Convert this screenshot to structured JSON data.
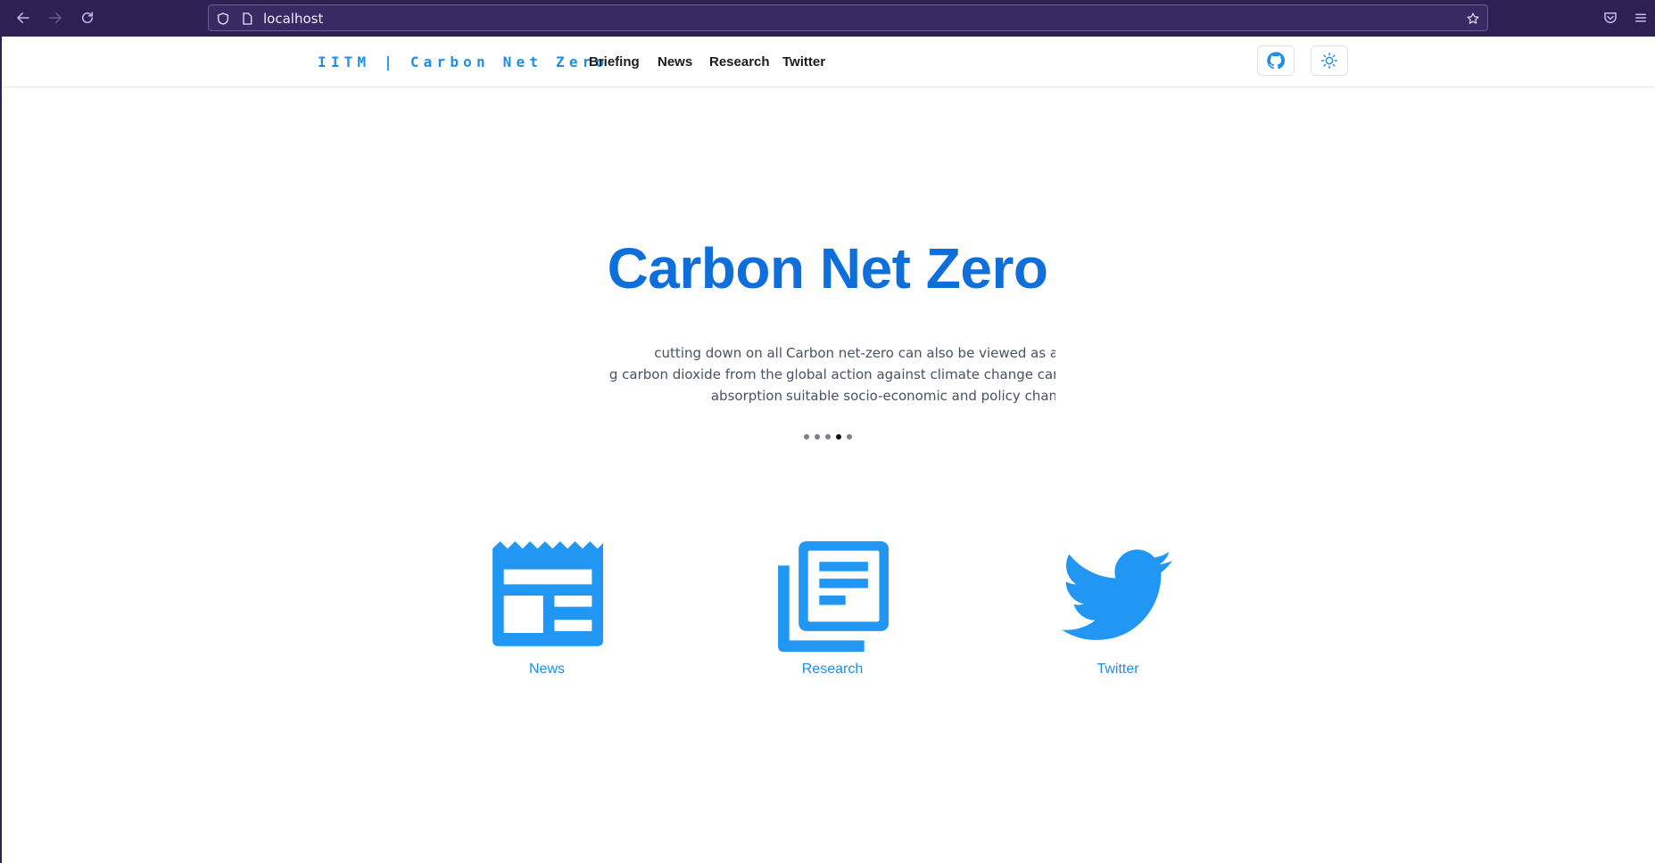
{
  "browser": {
    "url": "localhost"
  },
  "header": {
    "brand": "IITM | Carbon Net Zero",
    "nav": [
      "Briefing",
      "News",
      "Research",
      "Twitter"
    ]
  },
  "hero": {
    "title": "Carbon Net Zero",
    "slide_left": [
      "cutting down on all",
      "ng carbon dioxide from the",
      "absorption"
    ],
    "slide_right": [
      "Carbon net-zero can also be viewed as a f",
      "global action against climate change can l",
      "suitable socio-economic and policy chang"
    ],
    "dots_total": 5,
    "dots_active_index": 3
  },
  "cards": [
    {
      "label": "News",
      "icon": "newspaper-icon"
    },
    {
      "label": "Research",
      "icon": "article-stack-icon"
    },
    {
      "label": "Twitter",
      "icon": "twitter-bird-icon"
    }
  ],
  "colors": {
    "brand_blue": "#1f8ee6",
    "title_blue": "#0f6fda",
    "icon_blue": "#2196f3",
    "chrome_bg": "#2e2052"
  }
}
